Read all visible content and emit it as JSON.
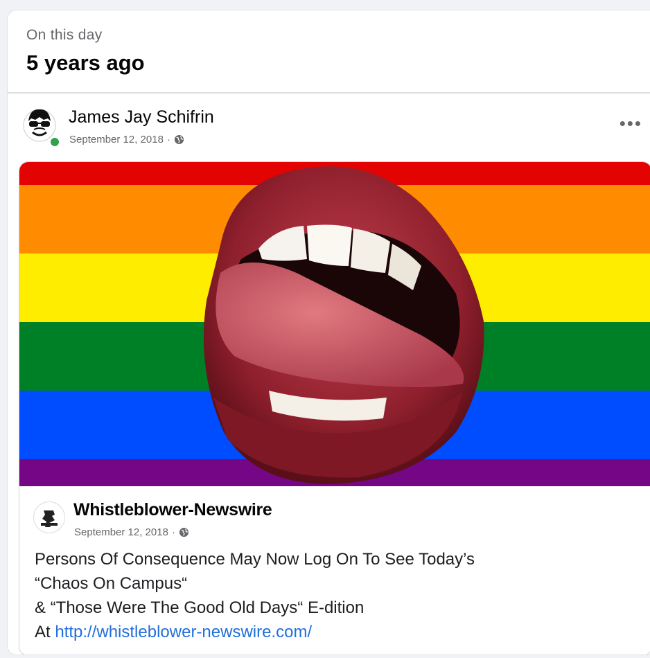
{
  "memory": {
    "eyebrow": "On this day",
    "headline": "5 years ago"
  },
  "post": {
    "author": "James Jay Schifrin",
    "date": "September 12, 2018",
    "separator": "·",
    "more_label": "•••",
    "privacy_icon": "globe-icon",
    "online": true
  },
  "shared_post": {
    "page_name": "Whistleblower-Newswire",
    "date": "September 12, 2018",
    "separator": "·",
    "privacy_icon": "globe-icon",
    "text_lines": [
      "Persons Of Consequence May Now Log On To See Today’s",
      "“Chaos On Campus“",
      "& “Those Were The Good Old Days“ E-dition"
    ],
    "link_prefix": "At ",
    "link_text": "http://whistleblower-newswire.com/"
  },
  "colors": {
    "link": "#216fdb",
    "online": "#31a24c",
    "flag": [
      "#e40303",
      "#ff8c00",
      "#ffed00",
      "#008026",
      "#004dff",
      "#750787"
    ]
  }
}
